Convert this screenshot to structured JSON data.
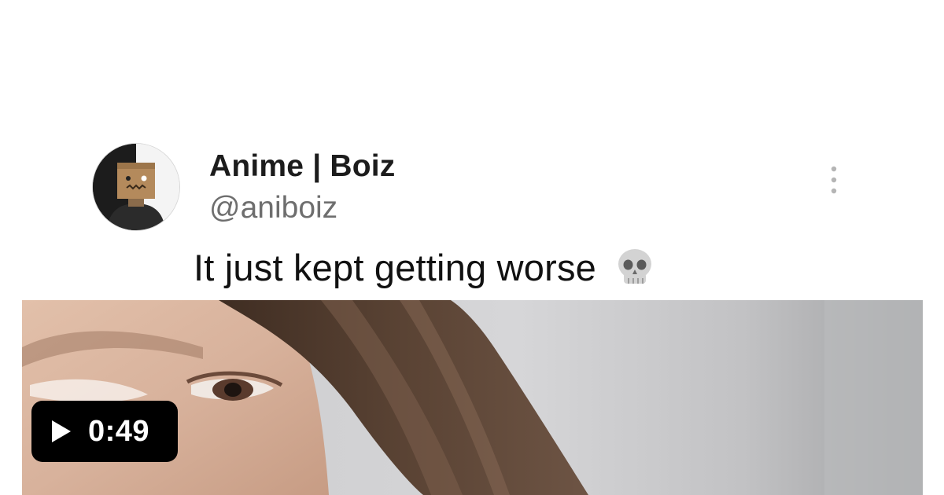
{
  "tweet": {
    "author": {
      "display_name": "Anime | Boiz",
      "handle": "@aniboiz",
      "avatar_icon": "box-head-avatar-icon"
    },
    "text": "It just kept getting worse",
    "emoji_icon": "skull-icon",
    "menu_icon": "more-options-icon"
  },
  "video": {
    "duration": "0:49",
    "play_icon": "play-icon"
  },
  "colors": {
    "background": "#ffffff",
    "duration_badge": "#000000",
    "handle_text": "#6e6e6e"
  }
}
